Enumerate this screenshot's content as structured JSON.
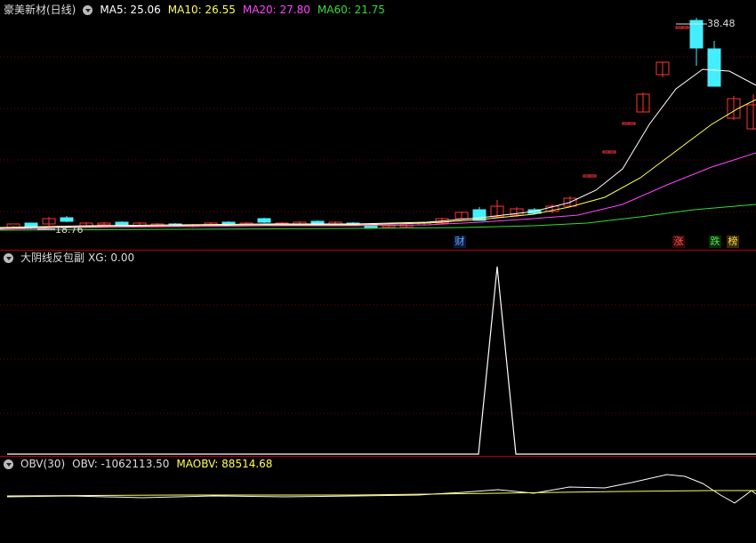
{
  "main_panel": {
    "stock_name": "豪美新材(日线)",
    "ma": [
      {
        "label": "MA5: 25.06",
        "color": "#ffffff"
      },
      {
        "label": "MA10: 26.55",
        "color": "#ffff55"
      },
      {
        "label": "MA20: 27.80",
        "color": "#ff44ff"
      },
      {
        "label": "MA60: 21.75",
        "color": "#33dd33"
      }
    ],
    "high_label": "38.48",
    "low_label": "18.76",
    "badges": [
      {
        "text": "财",
        "color": "#6aa8ff",
        "bg": "#0a1a3a"
      },
      {
        "text": "涨",
        "color": "#ff5555",
        "bg": "#3a0a0a"
      },
      {
        "text": "跌",
        "color": "#44ee44",
        "bg": "#0a2a0a"
      },
      {
        "text": "榜",
        "color": "#ffdd44",
        "bg": "#3a2a0a"
      }
    ]
  },
  "indicator_panel": {
    "name": "大阴线反包副",
    "value_label": "XG: 0.00"
  },
  "obv_panel": {
    "name": "OBV(30)",
    "obv_label": "OBV: -1062113.50",
    "maobv_label": "MAOBV: 88514.68"
  },
  "colors": {
    "up": "#ff3333",
    "down": "#44eeff",
    "separator": "#b40000",
    "grid": "#6a0000"
  }
}
